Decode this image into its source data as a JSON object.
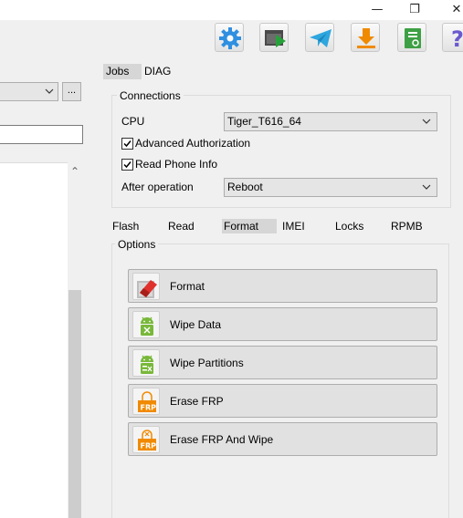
{
  "window": {
    "minimize_glyph": "—",
    "restore_glyph": "❐",
    "close_glyph": "✕"
  },
  "toolbar": [
    {
      "name": "settings-gear-button",
      "icon": "gear-icon",
      "color": "#2f8fe0"
    },
    {
      "name": "run-script-button",
      "icon": "window-play-icon",
      "color": "#27a23a"
    },
    {
      "name": "telegram-button",
      "icon": "telegram-icon",
      "color": "#2ea6de"
    },
    {
      "name": "download-update-button",
      "icon": "download-icon",
      "color": "#f08a00"
    },
    {
      "name": "log-button",
      "icon": "green-document-icon",
      "color": "#3ea044"
    },
    {
      "name": "help-button",
      "icon": "question-icon",
      "color": "#6a5acd"
    }
  ],
  "left_pane": {
    "browse_button": "..."
  },
  "top_tabs": {
    "jobs": "Jobs",
    "diag": "DIAG"
  },
  "connections": {
    "title": "Connections",
    "cpu_label": "CPU",
    "cpu_value": "Tiger_T616_64",
    "advanced_authorization": "Advanced Authorization",
    "advanced_authorization_checked": true,
    "read_phone_info": "Read Phone Info",
    "read_phone_info_checked": true,
    "after_operation_label": "After operation",
    "after_operation_value": "Reboot"
  },
  "sub_tabs": {
    "flash": "Flash",
    "read": "Read",
    "format": "Format",
    "imei": "IMEI",
    "locks": "Locks",
    "rpmb": "RPMB"
  },
  "options": {
    "title": "Options",
    "buttons": [
      {
        "label": "Format",
        "icon": "eraser-icon"
      },
      {
        "label": "Wipe Data",
        "icon": "android-wipe-icon"
      },
      {
        "label": "Wipe Partitions",
        "icon": "android-partitions-icon"
      },
      {
        "label": "Erase FRP",
        "icon": "frp-lock-icon"
      },
      {
        "label": "Erase FRP And Wipe",
        "icon": "frp-wipe-icon"
      }
    ]
  }
}
